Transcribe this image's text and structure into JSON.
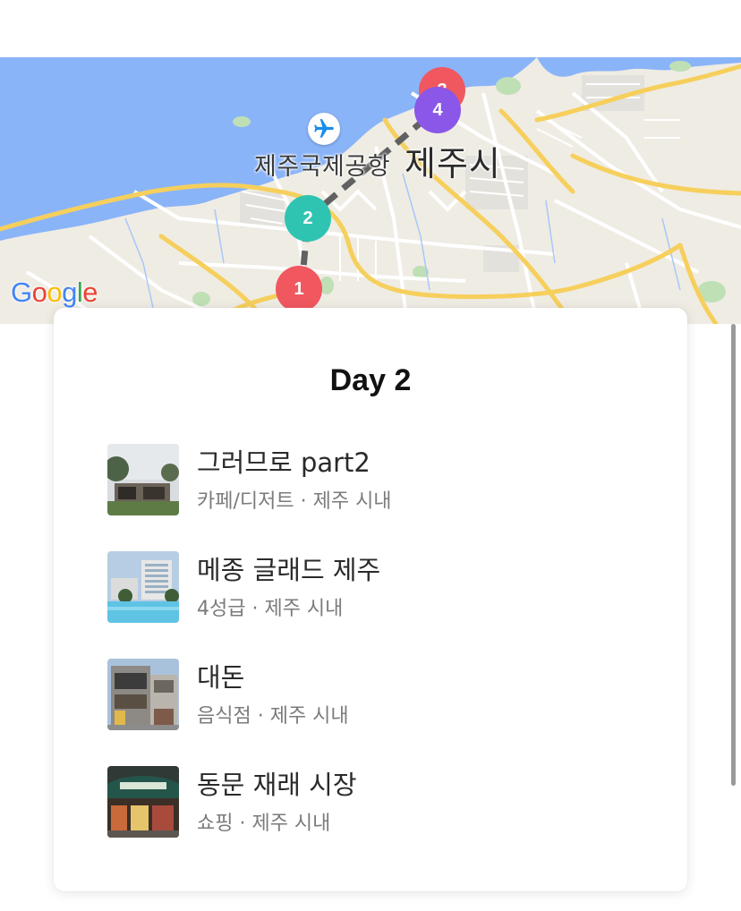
{
  "map": {
    "airport_label": "제주국제공항",
    "city_label": "제주시",
    "logo": "Google",
    "airport_icon": "airplane-icon",
    "markers": [
      {
        "label": "1",
        "color": "#F0575F"
      },
      {
        "label": "2",
        "color": "#2FC4B2"
      },
      {
        "label": "3",
        "color": "#F0575F"
      },
      {
        "label": "4",
        "color": "#8A57E8"
      }
    ]
  },
  "card": {
    "title": "Day 2",
    "places": [
      {
        "name": "그러므로 part2",
        "meta": "카페/디저트 · 제주 시내"
      },
      {
        "name": "메종 글래드 제주",
        "meta": "4성급 · 제주 시내"
      },
      {
        "name": "대돈",
        "meta": "음식점 · 제주 시내"
      },
      {
        "name": "동문 재래 시장",
        "meta": "쇼핑 · 제주 시내"
      }
    ]
  }
}
